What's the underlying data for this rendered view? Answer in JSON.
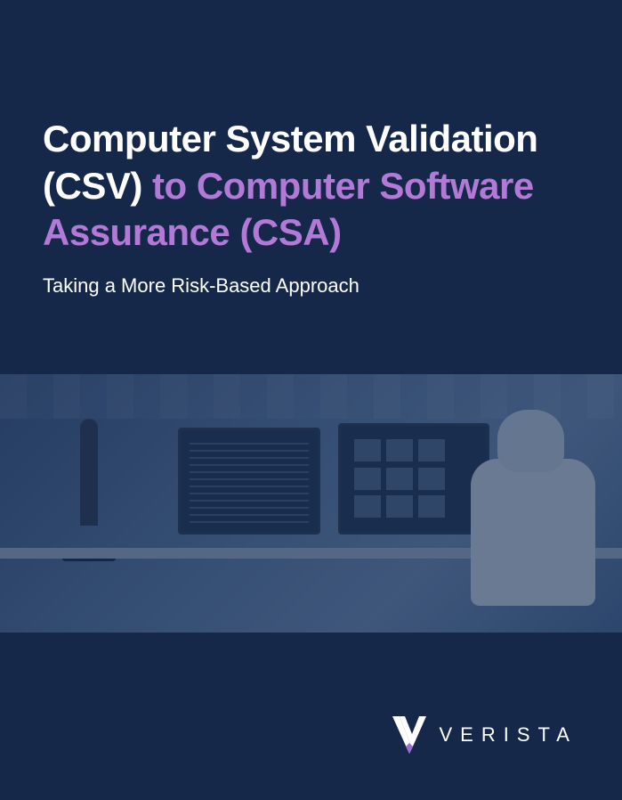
{
  "title": {
    "part1": "Computer System Validation (CSV)",
    "connector": " to ",
    "part2": "Computer Software Assurance (CSA)"
  },
  "subtitle": "Taking a More Risk-Based Approach",
  "brand": {
    "name": "VERISTA"
  }
}
